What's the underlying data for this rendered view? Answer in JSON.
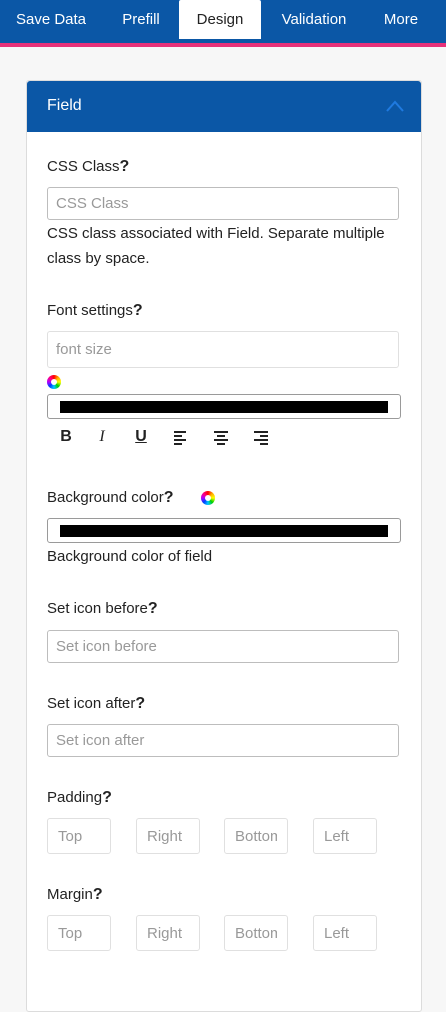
{
  "tabs": [
    {
      "label": "Save Data"
    },
    {
      "label": "Prefill"
    },
    {
      "label": "Design"
    },
    {
      "label": "Validation"
    },
    {
      "label": "More"
    }
  ],
  "panel": {
    "title": "Field",
    "css_class": {
      "label": "CSS Class",
      "q": "?",
      "placeholder": "CSS Class",
      "help": "CSS class associated with Field. Separate multiple class by space."
    },
    "font": {
      "label": "Font settings",
      "q": "?",
      "placeholder": "font size",
      "buttons": [
        "B",
        "I",
        "U"
      ]
    },
    "background": {
      "label": "Background color",
      "q": "?",
      "help": "Background color of field"
    },
    "icon_before": {
      "label": "Set icon before",
      "q": "?",
      "placeholder": "Set icon before"
    },
    "icon_after": {
      "label": "Set icon after",
      "q": "?",
      "placeholder": "Set icon after"
    },
    "padding": {
      "label": "Padding",
      "q": "?",
      "placeholders": [
        "Top",
        "Right",
        "Bottom",
        "Left"
      ]
    },
    "margin": {
      "label": "Margin",
      "q": "?",
      "placeholders": [
        "Top",
        "Right",
        "Bottom",
        "Left"
      ]
    }
  },
  "colors": {
    "brand": "#0b57a6",
    "accent": "#e8317a",
    "swatch": "#000000"
  }
}
